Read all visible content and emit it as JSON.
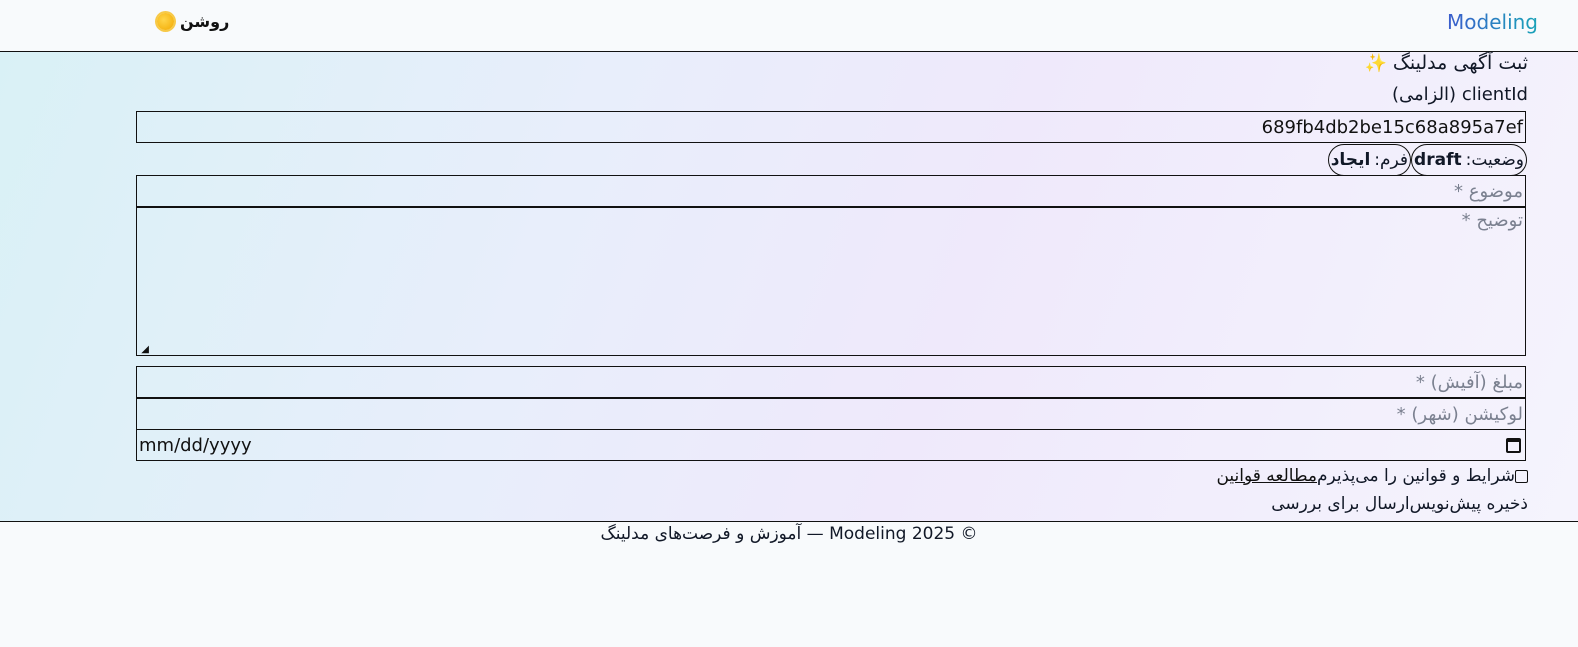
{
  "header": {
    "brand": "Modeling",
    "theme_label": "روشن",
    "theme_icon": "sun-icon"
  },
  "form": {
    "title": "ثبت آگهی مدلینگ",
    "title_icon": "sparkles-icon",
    "client_label": "clientId (الزامی)",
    "client_value": "689fb4db2be15c68a895a7ef",
    "status_label": "وضعیت:",
    "status_value": "draft",
    "form_label": "فرم:",
    "form_value": "ایجاد",
    "subject_placeholder": "موضوع *",
    "description_placeholder": "توضیح *",
    "price_placeholder": "مبلغ (آفیش) *",
    "location_placeholder": "لوکیشن (شهر) *",
    "date_placeholder": "mm/dd/yyyy",
    "terms_label": "شرایط و قوانین را می‌پذیرم",
    "terms_link": "مطالعه قوانین",
    "save_draft_label": "ذخیره پیش‌نویس",
    "submit_label": "ارسال برای بررسی"
  },
  "footer": {
    "text": "© 2025 Modeling — آموزش و فرصت‌های مدلینگ"
  },
  "colors": {
    "brand_start": "#3b5ccc",
    "brand_end": "#1aa3b8",
    "background": "#f8fafc"
  }
}
